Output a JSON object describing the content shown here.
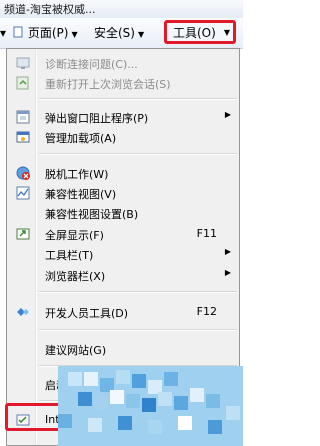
{
  "window": {
    "title": "频道-淘宝被权威..."
  },
  "command_bar": {
    "page_label": "页面(P)",
    "safety_label": "安全(S)",
    "tools_label": "工具(O)",
    "left_caret": "▾"
  },
  "menu": {
    "items": [
      {
        "label": "诊断连接问题(C)...",
        "icon": "diagnose-connection-icon",
        "disabled": true
      },
      {
        "label": "重新打开上次浏览会话(S)",
        "icon": "reopen-session-icon",
        "disabled": true
      },
      {
        "label": "弹出窗口阻止程序(P)",
        "icon": "popup-blocker-icon",
        "submenu": true
      },
      {
        "label": "管理加载项(A)",
        "icon": "manage-addons-icon"
      },
      {
        "label": "脱机工作(W)",
        "icon": "work-offline-icon"
      },
      {
        "label": "兼容性视图(V)",
        "icon": "compatibility-view-icon"
      },
      {
        "label": "兼容性视图设置(B)"
      },
      {
        "label": "全屏显示(F)",
        "icon": "fullscreen-icon",
        "shortcut": "F11"
      },
      {
        "label": "工具栏(T)",
        "submenu": true
      },
      {
        "label": "浏览器栏(X)",
        "submenu": true
      },
      {
        "label": "开发人员工具(D)",
        "icon": "developer-tools-icon",
        "shortcut": "F12"
      },
      {
        "label": "建议网站(G)"
      },
      {
        "label": "启动"
      },
      {
        "label": "Inte",
        "icon": "internet-options-icon"
      }
    ]
  },
  "colors": {
    "highlight_red": "#e2192a",
    "menu_bg": "#f0f0f0"
  }
}
